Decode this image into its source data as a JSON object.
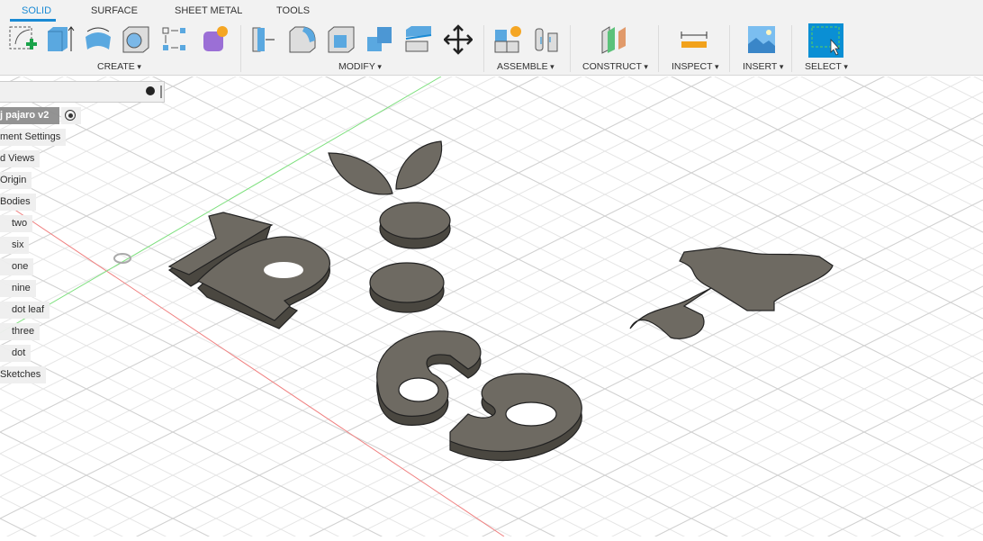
{
  "tabs": [
    {
      "label": "SOLID",
      "active": true
    },
    {
      "label": "SURFACE"
    },
    {
      "label": "SHEET METAL"
    },
    {
      "label": "TOOLS"
    }
  ],
  "groups": {
    "create": "CREATE",
    "modify": "MODIFY",
    "assemble": "ASSEMBLE",
    "construct": "CONSTRUCT",
    "inspect": "INSPECT",
    "insert": "INSERT",
    "select": "SELECT"
  },
  "browser": {
    "root": "j pajaro v2",
    "items": [
      "ment Settings",
      "d Views",
      "Origin",
      "Bodies"
    ],
    "bodies": [
      "two",
      "six",
      "one",
      "nine",
      "dot leaf",
      "three",
      "dot"
    ],
    "sketches": "Sketches"
  },
  "colors": {
    "accent": "#1a8ad4",
    "body": "#6e6a62",
    "x_axis": "#f08080",
    "y_axis": "#7ee07e"
  }
}
